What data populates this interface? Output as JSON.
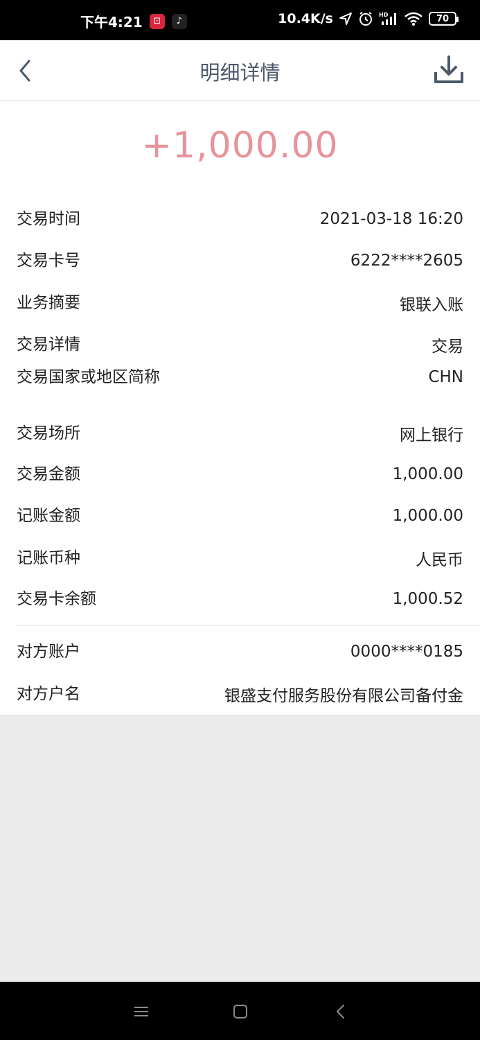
{
  "status_bar": {
    "time": "下午4:21",
    "network_speed": "10.4K/s",
    "battery": "70",
    "icons": [
      "icbc-app-icon",
      "tiktok-app-icon",
      "location-icon",
      "alarm-icon",
      "hd-signal-icon",
      "wifi-icon",
      "battery-icon"
    ]
  },
  "header": {
    "title": "明细详情",
    "icons": [
      "back-chevron-icon",
      "download-icon"
    ]
  },
  "amount": "+1,000.00",
  "colors": {
    "amount": "#e6949a",
    "title": "#4b5a6a",
    "background": "#ececec"
  },
  "details": [
    {
      "label": "交易时间",
      "value": "2021-03-18 16:20"
    },
    {
      "label": "交易卡号",
      "value": "6222****2605"
    },
    {
      "label": "业务摘要",
      "value": "银联入账"
    },
    {
      "label": "交易详情",
      "value": "交易"
    },
    {
      "label": "交易国家或地区简称",
      "value": "CHN"
    },
    {
      "label": "交易场所",
      "value": "网上银行"
    },
    {
      "label": "交易金额",
      "value": "1,000.00"
    },
    {
      "label": "记账金额",
      "value": "1,000.00"
    },
    {
      "label": "记账币种",
      "value": "人民币"
    },
    {
      "label": "交易卡余额",
      "value": "1,000.52"
    }
  ],
  "counterparty": [
    {
      "label": "对方账户",
      "value": "0000****0185"
    },
    {
      "label": "对方户名",
      "value": "银盛支付服务股份有限公司备付金"
    }
  ],
  "nav_bar": {
    "icons": [
      "menu-icon",
      "home-icon",
      "back-icon"
    ]
  }
}
